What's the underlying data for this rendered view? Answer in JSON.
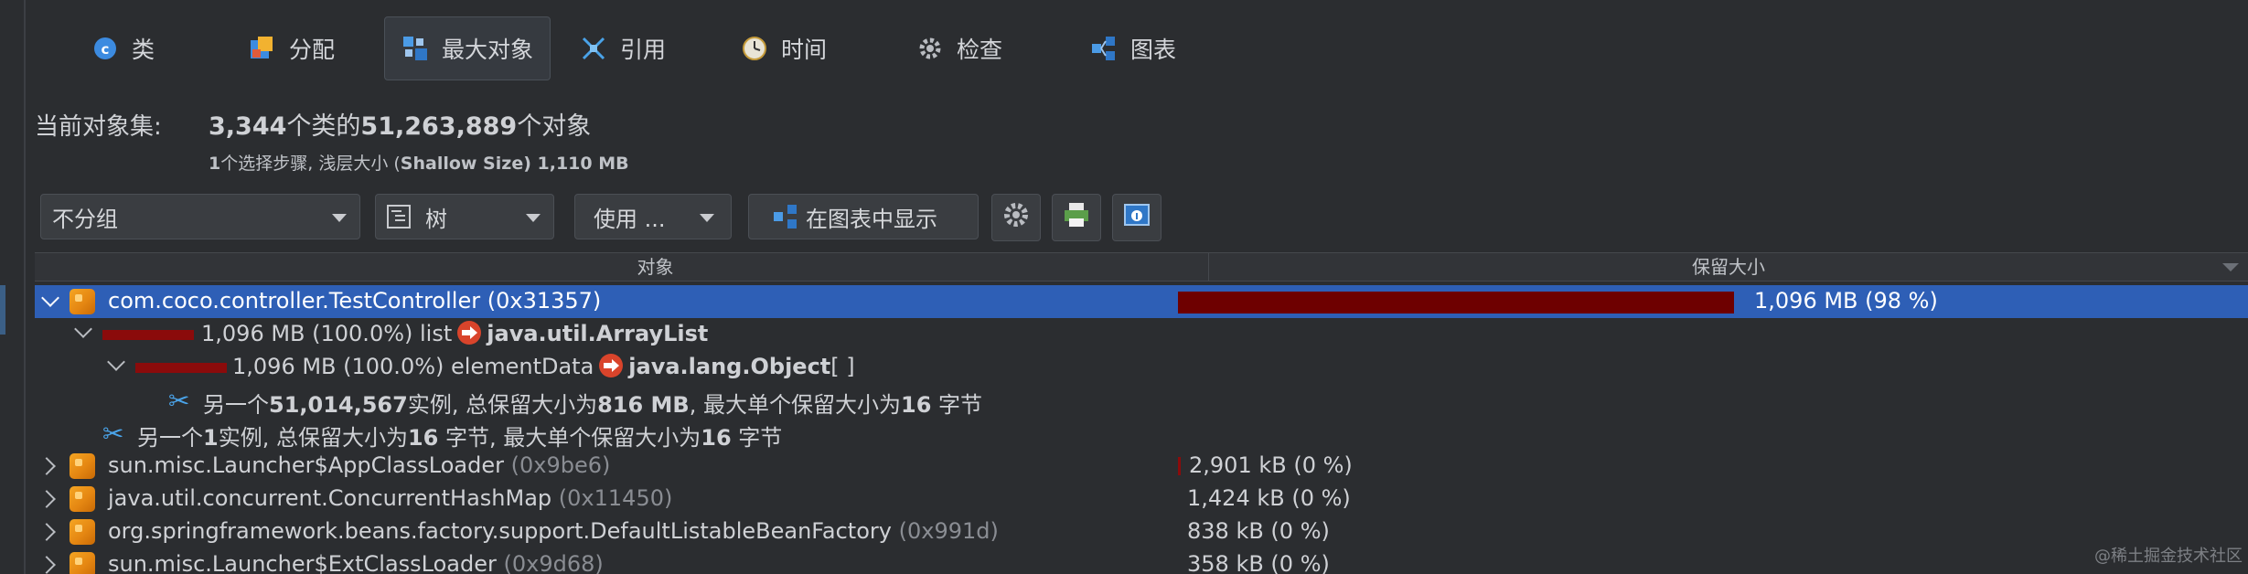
{
  "tabs": [
    {
      "label": "类",
      "icon": "class-icon"
    },
    {
      "label": "分配",
      "icon": "allocation-icon"
    },
    {
      "label": "最大对象",
      "icon": "biggest-objects-icon",
      "active": true
    },
    {
      "label": "引用",
      "icon": "references-icon"
    },
    {
      "label": "时间",
      "icon": "time-icon"
    },
    {
      "label": "检查",
      "icon": "inspect-icon"
    },
    {
      "label": "图表",
      "icon": "graph-icon"
    }
  ],
  "object_set": {
    "label": "当前对象集:",
    "class_count": "3,344",
    "text_classes": "个类的",
    "object_count": "51,263,889",
    "text_objects": "个对象",
    "steps_count": "1",
    "steps_text": "个选择步骤, 浅层大小 (",
    "shallow_label": "Shallow Size",
    "shallow_value": ") 1,110 MB"
  },
  "toolbar": {
    "grouping": "不分组",
    "view": "树",
    "use": "使用 ...",
    "show_in_graph": "在图表中显示"
  },
  "table": {
    "col_object": "对象",
    "col_retained": "保留大小",
    "rows": [
      {
        "name": "com.coco.controller.TestController",
        "addr": "(0x31357)",
        "size": "1,096 MB (98 %)",
        "fraction": 0.98
      },
      {
        "size_pct": "1,096 MB (100.0%)",
        "field": "list",
        "type": "java.util.ArrayList"
      },
      {
        "size_pct": "1,096 MB (100.0%)",
        "field": "elementData",
        "type": "java.lang.Object",
        "suffix": "[ ]"
      },
      {
        "pre": "另一个",
        "count": "51,014,567",
        "mid": "实例, 总保留大小为",
        "total": "816 MB",
        "mid2": ", 最大单个保留大小为",
        "max": "16",
        "post": " 字节"
      },
      {
        "pre": "另一个",
        "count": "1",
        "mid": "实例, 总保留大小为",
        "total": "16",
        "mid2": " 字节, 最大单个保留大小为",
        "max": "16",
        "post": " 字节"
      },
      {
        "name": "sun.misc.Launcher$AppClassLoader",
        "addr": "(0x9be6)",
        "size": "2,901 kB (0 %)"
      },
      {
        "name": "java.util.concurrent.ConcurrentHashMap",
        "addr": "(0x11450)",
        "size": "1,424 kB (0 %)"
      },
      {
        "name": "org.springframework.beans.factory.support.DefaultListableBeanFactory",
        "addr": "(0x991d)",
        "size": "838 kB (0 %)"
      },
      {
        "name": "sun.misc.Launcher$ExtClassLoader",
        "addr": "(0x9d68)",
        "size": "358 kB (0 %)"
      }
    ]
  },
  "watermark": "@稀土掘金技术社区",
  "colors": {
    "selection": "#2e5fb6",
    "size_bar": "#6e0000",
    "background": "#2b2d30"
  }
}
